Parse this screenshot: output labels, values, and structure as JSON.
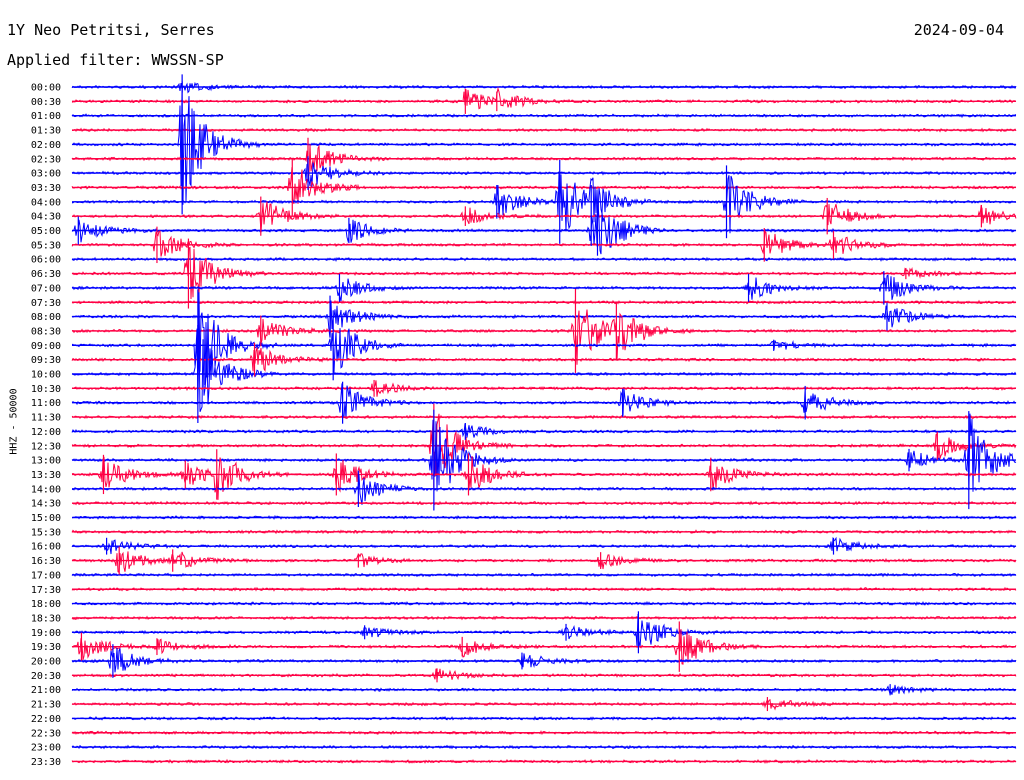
{
  "header": {
    "station": "1Y Neo Petritsi, Serres",
    "date": "2024-09-04",
    "filter": "Applied filter: WWSSN-SP"
  },
  "chart_data": {
    "type": "helicorder",
    "ylabel": "HHZ - 50000",
    "colors": [
      "#0000ff",
      "#ff0044"
    ],
    "rows": [
      "00:00",
      "00:30",
      "01:00",
      "01:30",
      "02:00",
      "02:30",
      "03:00",
      "03:30",
      "04:00",
      "04:30",
      "05:00",
      "05:30",
      "06:00",
      "06:30",
      "07:00",
      "07:30",
      "08:00",
      "08:30",
      "09:00",
      "09:30",
      "10:00",
      "10:30",
      "11:00",
      "11:30",
      "12:00",
      "12:30",
      "13:00",
      "13:30",
      "14:00",
      "14:30",
      "15:00",
      "15:30",
      "16:00",
      "16:30",
      "17:00",
      "17:30",
      "18:00",
      "18:30",
      "19:00",
      "19:30",
      "20:00",
      "20:30",
      "21:00",
      "21:30",
      "22:00",
      "22:30",
      "23:00",
      "23:30"
    ],
    "events": [
      {
        "row": "00:00",
        "minute": 3.5,
        "amp": 0.4
      },
      {
        "row": "00:30",
        "minute": 12.5,
        "amp": 0.9
      },
      {
        "row": "00:30",
        "minute": 13.5,
        "amp": 0.7
      },
      {
        "row": "02:00",
        "minute": 3.5,
        "amp": 5.0
      },
      {
        "row": "02:30",
        "minute": 7.5,
        "amp": 1.5
      },
      {
        "row": "03:00",
        "minute": 7.5,
        "amp": 1.2
      },
      {
        "row": "03:30",
        "minute": 7.0,
        "amp": 2.0
      },
      {
        "row": "04:00",
        "minute": 13.5,
        "amp": 1.2
      },
      {
        "row": "04:00",
        "minute": 15.5,
        "amp": 3.0
      },
      {
        "row": "04:00",
        "minute": 20.8,
        "amp": 2.6
      },
      {
        "row": "04:00",
        "minute": 16.5,
        "amp": 1.2
      },
      {
        "row": "04:30",
        "minute": 6.0,
        "amp": 1.4
      },
      {
        "row": "04:30",
        "minute": 12.5,
        "amp": 0.7
      },
      {
        "row": "04:30",
        "minute": 24.0,
        "amp": 1.3
      },
      {
        "row": "04:30",
        "minute": 28.9,
        "amp": 0.8
      },
      {
        "row": "05:00",
        "minute": 0.2,
        "amp": 1.0
      },
      {
        "row": "05:00",
        "minute": 8.8,
        "amp": 0.9
      },
      {
        "row": "05:00",
        "minute": 16.5,
        "amp": 1.1
      },
      {
        "row": "05:00",
        "minute": 16.7,
        "amp": 1.8
      },
      {
        "row": "05:30",
        "minute": 2.7,
        "amp": 1.3
      },
      {
        "row": "05:30",
        "minute": 22.0,
        "amp": 1.2
      },
      {
        "row": "05:30",
        "minute": 24.2,
        "amp": 1.0
      },
      {
        "row": "06:30",
        "minute": 3.7,
        "amp": 2.5
      },
      {
        "row": "06:30",
        "minute": 26.5,
        "amp": 0.4
      },
      {
        "row": "07:00",
        "minute": 8.5,
        "amp": 1.0
      },
      {
        "row": "07:00",
        "minute": 21.5,
        "amp": 1.0
      },
      {
        "row": "07:00",
        "minute": 25.8,
        "amp": 1.2
      },
      {
        "row": "08:00",
        "minute": 8.2,
        "amp": 1.5
      },
      {
        "row": "08:00",
        "minute": 25.9,
        "amp": 1.0
      },
      {
        "row": "08:30",
        "minute": 6.0,
        "amp": 1.1
      },
      {
        "row": "08:30",
        "minute": 16.0,
        "amp": 3.0
      },
      {
        "row": "08:30",
        "minute": 17.3,
        "amp": 2.0
      },
      {
        "row": "09:00",
        "minute": 4.0,
        "amp": 4.0
      },
      {
        "row": "09:00",
        "minute": 8.3,
        "amp": 2.5
      },
      {
        "row": "09:00",
        "minute": 22.3,
        "amp": 0.4
      },
      {
        "row": "09:30",
        "minute": 5.8,
        "amp": 1.2
      },
      {
        "row": "10:00",
        "minute": 4.0,
        "amp": 3.5
      },
      {
        "row": "10:30",
        "minute": 9.6,
        "amp": 0.6
      },
      {
        "row": "11:00",
        "minute": 8.6,
        "amp": 1.5
      },
      {
        "row": "11:00",
        "minute": 17.5,
        "amp": 1.0
      },
      {
        "row": "11:00",
        "minute": 23.3,
        "amp": 1.2
      },
      {
        "row": "12:00",
        "minute": 12.5,
        "amp": 0.6
      },
      {
        "row": "12:30",
        "minute": 11.5,
        "amp": 3.0
      },
      {
        "row": "12:30",
        "minute": 27.5,
        "amp": 1.0
      },
      {
        "row": "13:00",
        "minute": 11.5,
        "amp": 3.6
      },
      {
        "row": "13:00",
        "minute": 26.6,
        "amp": 0.8
      },
      {
        "row": "13:00",
        "minute": 28.5,
        "amp": 3.5
      },
      {
        "row": "13:30",
        "minute": 1.0,
        "amp": 1.4
      },
      {
        "row": "13:30",
        "minute": 3.6,
        "amp": 1.0
      },
      {
        "row": "13:30",
        "minute": 4.6,
        "amp": 1.8
      },
      {
        "row": "13:30",
        "minute": 8.4,
        "amp": 1.5
      },
      {
        "row": "13:30",
        "minute": 12.6,
        "amp": 1.5
      },
      {
        "row": "13:30",
        "minute": 20.3,
        "amp": 1.2
      },
      {
        "row": "14:00",
        "minute": 9.1,
        "amp": 1.3
      },
      {
        "row": "16:00",
        "minute": 1.1,
        "amp": 0.6
      },
      {
        "row": "16:00",
        "minute": 24.2,
        "amp": 0.6
      },
      {
        "row": "16:30",
        "minute": 1.5,
        "amp": 1.0
      },
      {
        "row": "16:30",
        "minute": 3.2,
        "amp": 0.8
      },
      {
        "row": "16:30",
        "minute": 9.1,
        "amp": 0.5
      },
      {
        "row": "16:30",
        "minute": 16.8,
        "amp": 0.6
      },
      {
        "row": "19:00",
        "minute": 9.3,
        "amp": 0.5
      },
      {
        "row": "19:00",
        "minute": 15.7,
        "amp": 0.6
      },
      {
        "row": "19:00",
        "minute": 18.0,
        "amp": 1.5
      },
      {
        "row": "19:30",
        "minute": 0.3,
        "amp": 1.0
      },
      {
        "row": "19:30",
        "minute": 2.7,
        "amp": 0.6
      },
      {
        "row": "19:30",
        "minute": 12.4,
        "amp": 0.7
      },
      {
        "row": "19:30",
        "minute": 19.3,
        "amp": 1.8
      },
      {
        "row": "20:00",
        "minute": 1.3,
        "amp": 1.2
      },
      {
        "row": "20:00",
        "minute": 14.3,
        "amp": 0.6
      },
      {
        "row": "20:30",
        "minute": 11.6,
        "amp": 0.5
      },
      {
        "row": "21:00",
        "minute": 26.0,
        "amp": 0.4
      },
      {
        "row": "21:30",
        "minute": 22.1,
        "amp": 0.5
      }
    ]
  }
}
